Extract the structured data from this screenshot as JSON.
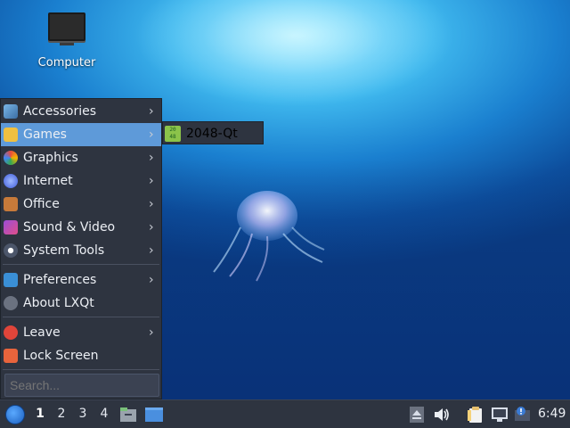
{
  "desktop": {
    "icons": [
      {
        "label": "Computer",
        "icon": "computer-icon"
      }
    ]
  },
  "menu": {
    "items": [
      {
        "label": "Accessories",
        "icon": "accessories-icon",
        "submenu": true
      },
      {
        "label": "Games",
        "icon": "games-icon",
        "submenu": true,
        "active": true
      },
      {
        "label": "Graphics",
        "icon": "graphics-icon",
        "submenu": true
      },
      {
        "label": "Internet",
        "icon": "internet-icon",
        "submenu": true
      },
      {
        "label": "Office",
        "icon": "office-icon",
        "submenu": true
      },
      {
        "label": "Sound & Video",
        "icon": "sound-video-icon",
        "submenu": true
      },
      {
        "label": "System Tools",
        "icon": "system-tools-icon",
        "submenu": true
      },
      {
        "label": "Preferences",
        "icon": "preferences-icon",
        "submenu": true
      },
      {
        "label": "About LXQt",
        "icon": "info-icon",
        "submenu": false
      },
      {
        "label": "Leave",
        "icon": "power-icon",
        "submenu": true
      },
      {
        "label": "Lock Screen",
        "icon": "lock-icon",
        "submenu": false
      }
    ],
    "submenu_arrow": "›",
    "search_placeholder": "Search..."
  },
  "games_submenu": {
    "items": [
      {
        "label": "2048-Qt",
        "icon": "2048-icon",
        "icon_text": "20 48"
      }
    ]
  },
  "taskbar": {
    "workspaces": [
      "1",
      "2",
      "3",
      "4"
    ],
    "active_workspace": "1",
    "clock": "6:49",
    "quicklaunch": [
      "file-manager-icon",
      "show-desktop-icon"
    ],
    "tray": [
      "eject-icon",
      "volume-icon",
      "clipboard-icon",
      "network-icon",
      "update-notifier-icon"
    ]
  },
  "colors": {
    "menu_bg": "#2e3440",
    "highlight": "#5e9ad9",
    "panel_bg": "#2e3440"
  }
}
